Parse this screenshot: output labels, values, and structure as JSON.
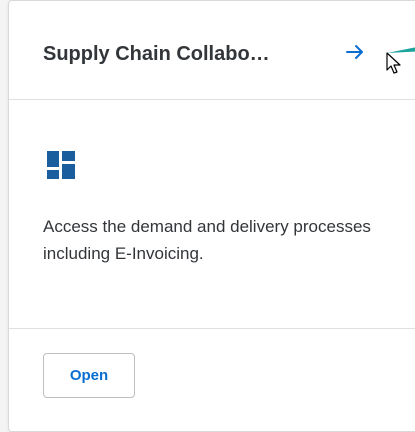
{
  "card": {
    "title": "Supply Chain Collabo…",
    "description": "Access the demand and delivery processes including E-Invoicing.",
    "open_label": "Open",
    "icons": {
      "navigate": "arrow-right-icon",
      "tile": "tiles-grid-icon",
      "cursor": "mouse-pointer-icon"
    }
  },
  "colors": {
    "accent": "#0a6ed1",
    "icon_blue": "#1a5e9e",
    "title_text": "#32363a",
    "teal": "#1ba39c"
  }
}
